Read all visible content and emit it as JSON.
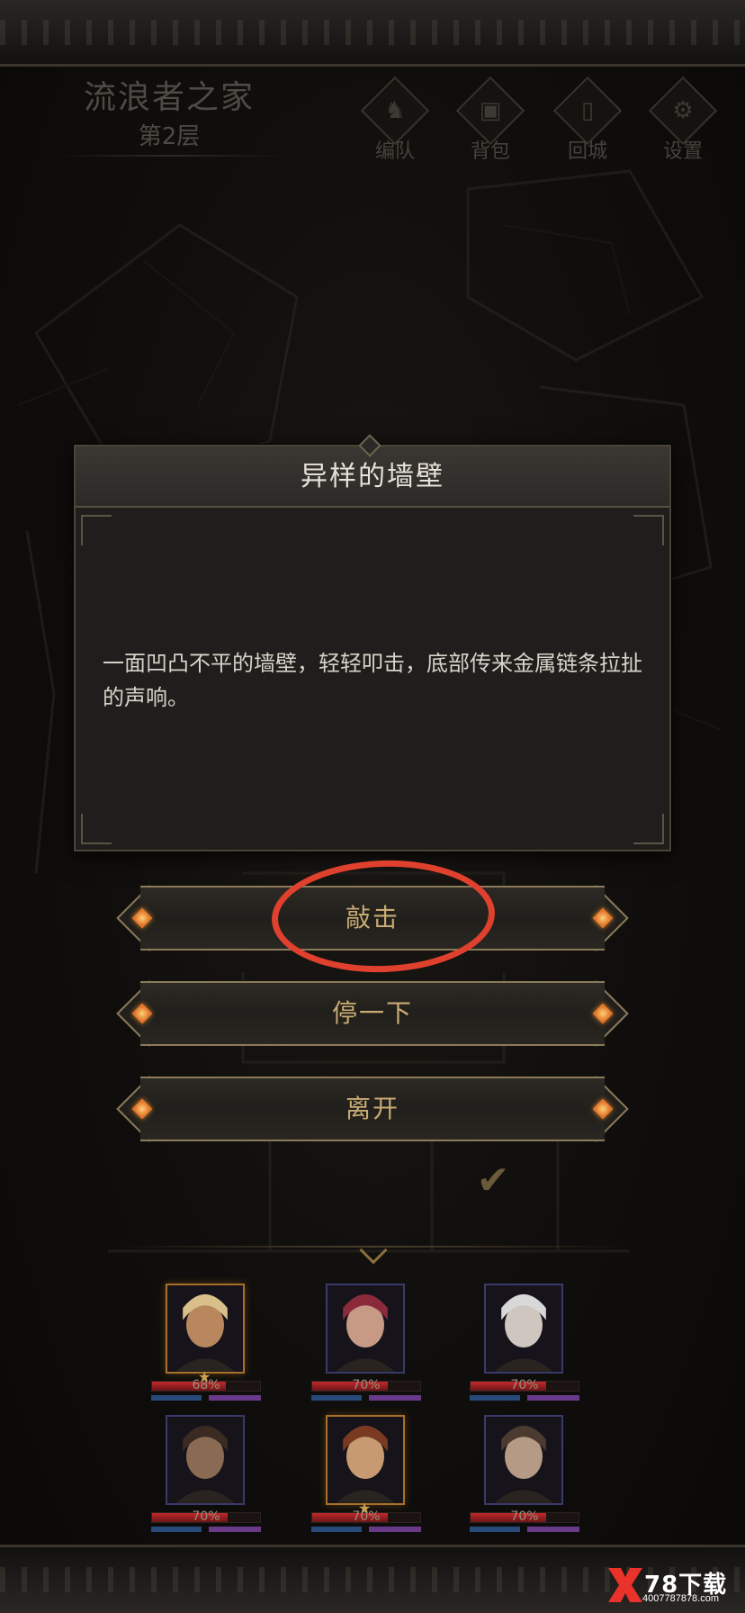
{
  "header": {
    "floor_name": "流浪者之家",
    "floor_level": "第2层"
  },
  "menu": [
    {
      "label": "编队",
      "icon": "horned-helmet-icon"
    },
    {
      "label": "背包",
      "icon": "backpack-icon"
    },
    {
      "label": "回城",
      "icon": "door-icon"
    },
    {
      "label": "设置",
      "icon": "gear-icon"
    }
  ],
  "dialog": {
    "title": "异样的墙壁",
    "body": "一面凹凸不平的墙壁，轻轻叩击，底部传来金属链条拉扯的声响。"
  },
  "choices": [
    {
      "label": "敲击",
      "highlighted": true
    },
    {
      "label": "停一下"
    },
    {
      "label": "离开"
    }
  ],
  "party": [
    {
      "hp_text": "68%",
      "hp": 0.68,
      "frame": "gold",
      "star": true
    },
    {
      "hp_text": "70%",
      "hp": 0.7,
      "frame": "blue",
      "star": false
    },
    {
      "hp_text": "70%",
      "hp": 0.7,
      "frame": "blue",
      "star": false
    },
    {
      "hp_text": "70%",
      "hp": 0.7,
      "frame": "blue",
      "star": false
    },
    {
      "hp_text": "70%",
      "hp": 0.7,
      "frame": "gold",
      "star": true
    },
    {
      "hp_text": "70%",
      "hp": 0.7,
      "frame": "blue",
      "star": false
    }
  ],
  "colors": {
    "accent_gold": "#c9ab74",
    "highlight_ring": "#e0402e",
    "gem": "#e2772a"
  },
  "watermark": {
    "brand": "78下载",
    "url": "4007787878.com"
  }
}
